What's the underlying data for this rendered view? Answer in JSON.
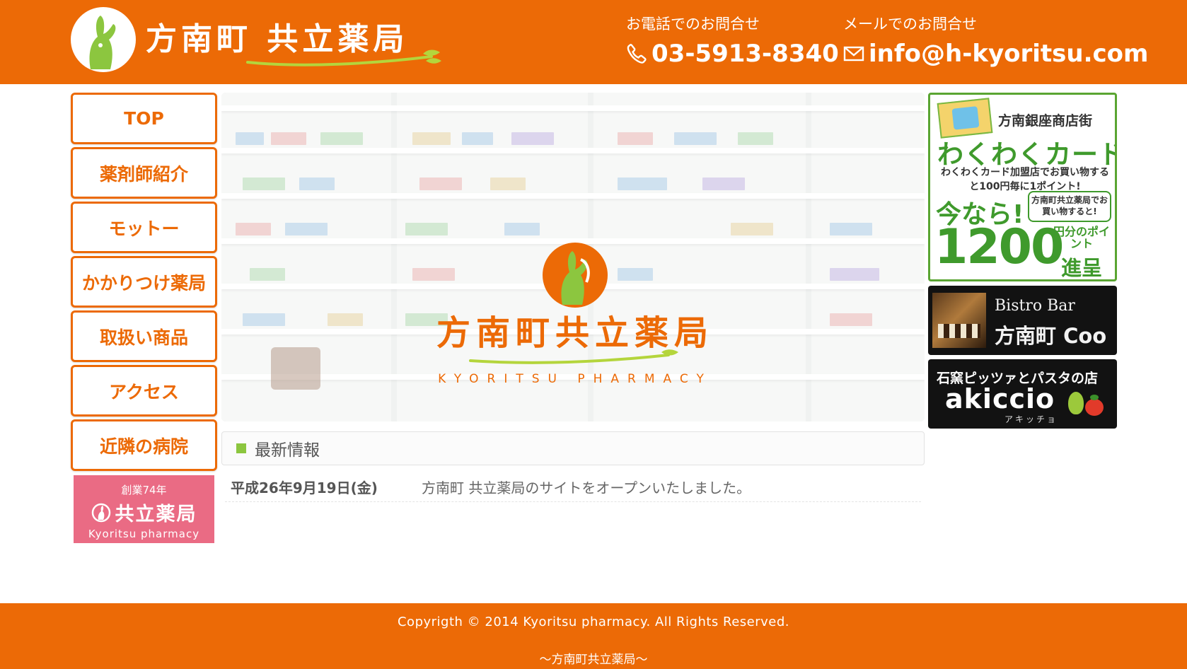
{
  "header": {
    "logo_text": "方南町 共立薬局",
    "phone_label": "お電話でのお問合せ",
    "phone_number": "03-5913-8340",
    "mail_label": "メールでのお問合せ",
    "mail_address": "info@h-kyoritsu.com"
  },
  "nav": {
    "items": [
      {
        "label": "TOP"
      },
      {
        "label": "薬剤師紹介"
      },
      {
        "label": "モットー"
      },
      {
        "label": "かかりつけ薬局"
      },
      {
        "label": "取扱い商品"
      },
      {
        "label": "アクセス"
      },
      {
        "label": "近隣の病院"
      }
    ],
    "banner": {
      "top": "創業74年",
      "name": "共立薬局",
      "sub": "Kyoritsu pharmacy"
    }
  },
  "hero": {
    "name": "方南町共立薬局",
    "english": "KYORITSU PHARMACY"
  },
  "news": {
    "title": "最新情報",
    "items": [
      {
        "date": "平成26年9月19日(金)",
        "text": "方南町 共立薬局のサイトをオープンいたしました。"
      }
    ]
  },
  "banners": {
    "wakuwaku": {
      "title": "方南銀座商店街",
      "big": "わくわくカード",
      "sub": "わくわくカード加盟店でお買い物すると100円毎に1ポイント!",
      "now": "今なら!",
      "bubble": "方南町共立薬局でお買い物すると!",
      "number": "1200",
      "unit": "円分のポイント",
      "gift": "進呈"
    },
    "coo": {
      "line1": "Bistro Bar",
      "line2": "方南町 Coo"
    },
    "akiccio": {
      "line1": "石窯ピッツァとパスタの店",
      "line2": "akiccio",
      "kana": "アキッチョ"
    }
  },
  "footer": {
    "copyright": "Copyrigth © 2014 Kyoritsu pharmacy. All Rights Reserved.",
    "tagline": "～方南町共立薬局～"
  },
  "colors": {
    "brand_orange": "#ec6a06",
    "accent_green": "#8cc63f",
    "banner_pink": "#ea6b84"
  },
  "icons": {
    "phone": "phone-icon",
    "mail": "mail-icon",
    "logo": "rabbit-logo-icon"
  }
}
